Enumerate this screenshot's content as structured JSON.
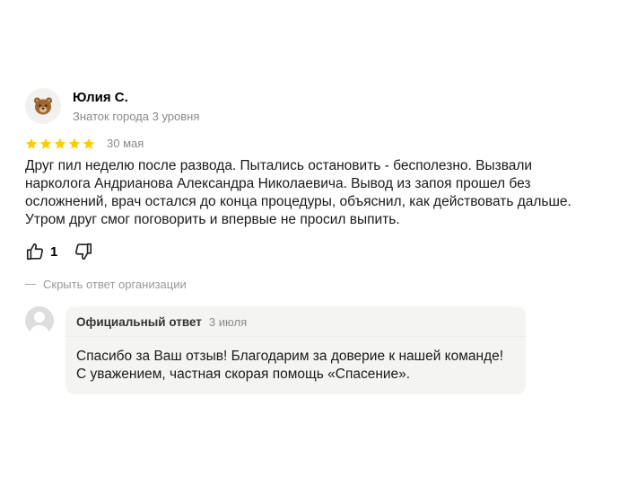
{
  "review": {
    "author": {
      "name": "Юлия С.",
      "level": "Знаток города 3 уровня",
      "avatar_icon": "bear-icon"
    },
    "rating": 5,
    "date": "30 мая",
    "text": "Друг пил неделю после развода. Пытались остановить - бесполезно. Вызвали нарколога Андрианова Александра Николаевича. Вывод из запоя прошел без осложнений, врач остался до конца процедуры, объяснил, как действовать дальше. Утром друг смог поговорить и впервые не просил выпить.",
    "likes": "1",
    "hide_reply_label": "Скрыть ответ организации",
    "colors": {
      "star": "#ffcc00",
      "muted": "#8a8a8a",
      "bubble": "#f4f4f3"
    }
  },
  "reply": {
    "title": "Официальный ответ",
    "date": "3 июля",
    "text": "Спасибо за Ваш отзыв! Благодарим за доверие к нашей команде!\nС уважением, частная скорая помощь «Спасение»."
  }
}
